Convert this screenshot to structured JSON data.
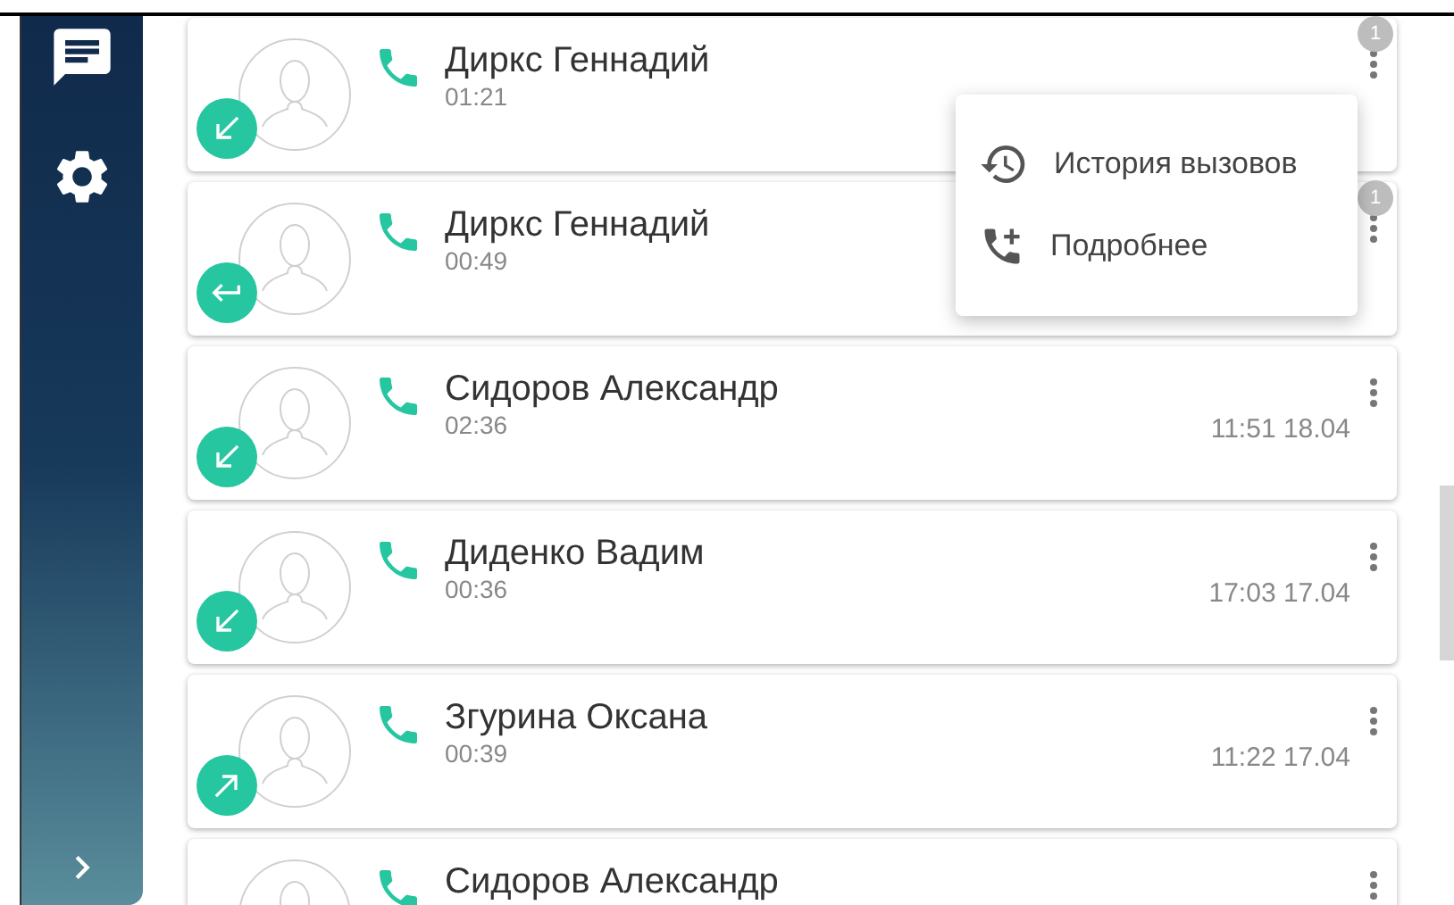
{
  "calls": [
    {
      "name": "Диркс Геннадий",
      "duration": "01:21",
      "kind": "incoming",
      "unread": "1"
    },
    {
      "name": "Диркс Геннадий",
      "duration": "00:49",
      "kind": "returned",
      "unread": "1"
    },
    {
      "name": "Сидоров Александр",
      "duration": "02:36",
      "kind": "incoming",
      "time": "11:51 18.04"
    },
    {
      "name": "Диденко Вадим",
      "duration": "00:36",
      "kind": "incoming",
      "time": "17:03 17.04"
    },
    {
      "name": "Згурина Оксана",
      "duration": "00:39",
      "kind": "outgoing",
      "time": "11:22 17.04"
    },
    {
      "name": "Сидоров Александр"
    }
  ],
  "menu": [
    {
      "kind": "history",
      "label": "История вызовов"
    },
    {
      "kind": "details",
      "label": "Подробнее"
    }
  ]
}
